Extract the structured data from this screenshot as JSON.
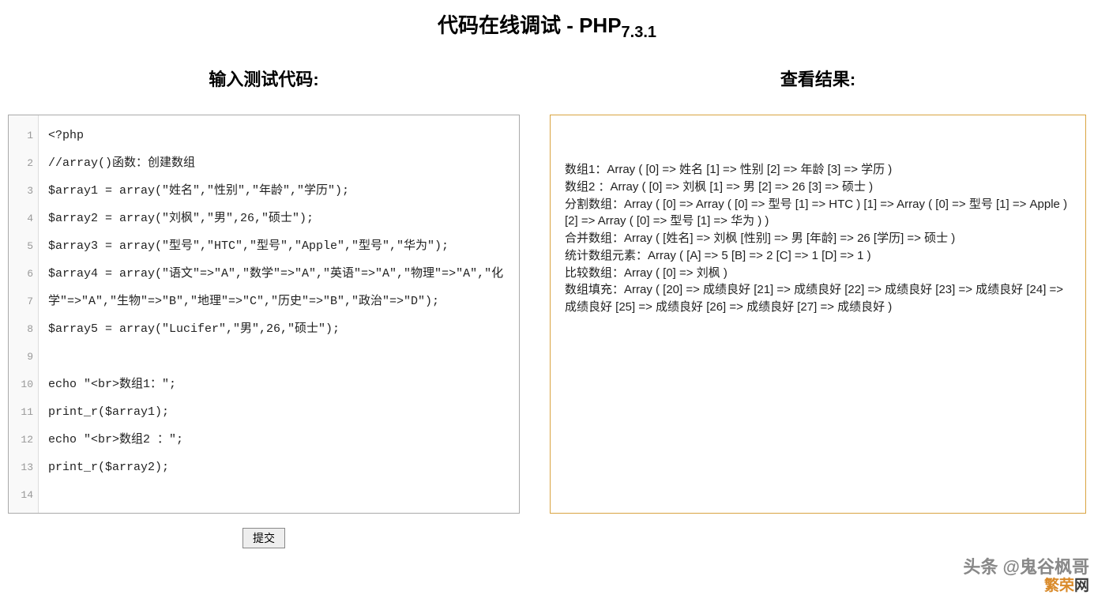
{
  "header": {
    "title_main": "代码在线调试 - PHP",
    "version": "7.3.1"
  },
  "left": {
    "title": "输入测试代码:",
    "code_lines": [
      "<?php",
      "//array()函数：创建数组",
      "$array1 = array(\"姓名\",\"性别\",\"年龄\",\"学历\");",
      "$array2 = array(\"刘枫\",\"男\",26,\"硕士\");",
      "$array3 = array(\"型号\",\"HTC\",\"型号\",\"Apple\",\"型号\",\"华为\");",
      "$array4 = array(\"语文\"=>\"A\",\"数学\"=>\"A\",\"英语\"=>\"A\",\"物理\"=>\"A\",\"化学\"=>\"A\",\"生物\"=>\"B\",\"地理\"=>\"C\",\"历史\"=>\"B\",\"政治\"=>\"D\");",
      "$array5 = array(\"Lucifer\",\"男\",26,\"硕士\");",
      "",
      "echo \"<br>数组1：\";",
      "print_r($array1);",
      "echo \"<br>数组2 ：\";",
      "print_r($array2);",
      ""
    ],
    "line_numbers": [
      "1",
      "2",
      "3",
      "4",
      "5",
      "6",
      "7",
      "8",
      "9",
      "10",
      "11",
      "12",
      "13",
      "14"
    ],
    "submit_label": "提交"
  },
  "right": {
    "title": "查看结果:",
    "output": "数组1：Array ( [0] => 姓名 [1] => 性别 [2] => 年龄 [3] => 学历 )\n数组2 ：Array ( [0] => 刘枫 [1] => 男 [2] => 26 [3] => 硕士 )\n分割数组：Array ( [0] => Array ( [0] => 型号 [1] => HTC ) [1] => Array ( [0] => 型号 [1] => Apple ) [2] => Array ( [0] => 型号 [1] => 华为 ) )\n合并数组：Array ( [姓名] => 刘枫 [性别] => 男 [年龄] => 26 [学历] => 硕士 )\n统计数组元素：Array ( [A] => 5 [B] => 2 [C] => 1 [D] => 1 )\n比较数组：Array ( [0] => 刘枫 )\n数组填充：Array ( [20] => 成绩良好 [21] => 成绩良好 [22] => 成绩良好 [23] => 成绩良好 [24] => 成绩良好 [25] => 成绩良好 [26] => 成绩良好 [27] => 成绩良好 )"
  },
  "watermark": {
    "top": "头条 @鬼谷枫哥",
    "bottom_1": "繁荣",
    "bottom_2": "网"
  }
}
